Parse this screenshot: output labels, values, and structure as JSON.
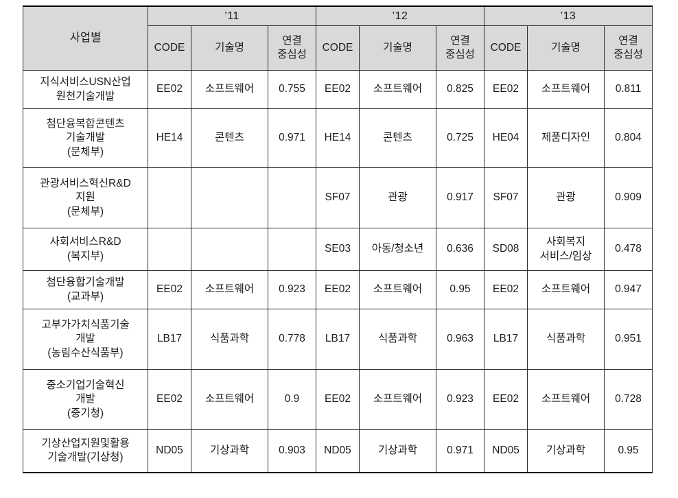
{
  "table": {
    "header": {
      "row_label": "사업별",
      "years": [
        "’11",
        "’12",
        "’13"
      ],
      "sub_columns": [
        "CODE",
        "기술명",
        "연결\n중심성"
      ],
      "sub_code": "CODE",
      "sub_tech": "기술명",
      "sub_centrality_line1": "연결",
      "sub_centrality_line2": "중심성"
    },
    "rows": [
      {
        "name_lines": [
          "지식서비스USN산업",
          "원천기술개발"
        ],
        "y11": {
          "code": "EE02",
          "tech": "소프트웨어",
          "centrality": "0.755"
        },
        "y12": {
          "code": "EE02",
          "tech": "소프트웨어",
          "centrality": "0.825"
        },
        "y13": {
          "code": "EE02",
          "tech": "소프트웨어",
          "centrality": "0.811"
        }
      },
      {
        "name_lines": [
          "첨단융복합콘텐츠",
          "기술개발",
          "(문체부)"
        ],
        "y11": {
          "code": "HE14",
          "tech": "콘텐츠",
          "centrality": "0.971"
        },
        "y12": {
          "code": "HE14",
          "tech": "콘텐츠",
          "centrality": "0.725"
        },
        "y13": {
          "code": "HE04",
          "tech": "제품디자인",
          "centrality": "0.804"
        }
      },
      {
        "name_lines": [
          "관광서비스혁신R&D",
          "지원",
          "(문체부)"
        ],
        "y11": {
          "code": "",
          "tech": "",
          "centrality": ""
        },
        "y12": {
          "code": "SF07",
          "tech": "관광",
          "centrality": "0.917"
        },
        "y13": {
          "code": "SF07",
          "tech": "관광",
          "centrality": "0.909"
        }
      },
      {
        "name_lines": [
          "사회서비스R&D",
          "(복지부)"
        ],
        "y11": {
          "code": "",
          "tech": "",
          "centrality": ""
        },
        "y12": {
          "code": "SE03",
          "tech": "아동/청소년",
          "centrality": "0.636"
        },
        "y13": {
          "code": "SD08",
          "tech": "사회복지\n서비스/임상",
          "centrality": "0.478"
        }
      },
      {
        "name_lines": [
          "첨단융합기술개발",
          "(교과부)"
        ],
        "y11": {
          "code": "EE02",
          "tech": "소프트웨어",
          "centrality": "0.923"
        },
        "y12": {
          "code": "EE02",
          "tech": "소프트웨어",
          "centrality": "0.95"
        },
        "y13": {
          "code": "EE02",
          "tech": "소프트웨어",
          "centrality": "0.947"
        }
      },
      {
        "name_lines": [
          "고부가가치식품기술",
          "개발",
          "(농림수산식품부)"
        ],
        "y11": {
          "code": "LB17",
          "tech": "식품과학",
          "centrality": "0.778"
        },
        "y12": {
          "code": "LB17",
          "tech": "식품과학",
          "centrality": "0.963"
        },
        "y13": {
          "code": "LB17",
          "tech": "식품과학",
          "centrality": "0.951"
        }
      },
      {
        "name_lines": [
          "중소기업기술혁신",
          "개발",
          "(중기청)"
        ],
        "y11": {
          "code": "EE02",
          "tech": "소프트웨어",
          "centrality": "0.9"
        },
        "y12": {
          "code": "EE02",
          "tech": "소프트웨어",
          "centrality": "0.923"
        },
        "y13": {
          "code": "EE02",
          "tech": "소프트웨어",
          "centrality": "0.728"
        }
      },
      {
        "name_lines": [
          "기상산업지원및활용",
          "기술개발(기상청)"
        ],
        "y11": {
          "code": "ND05",
          "tech": "기상과학",
          "centrality": "0.903"
        },
        "y12": {
          "code": "ND05",
          "tech": "기상과학",
          "centrality": "0.971"
        },
        "y13": {
          "code": "ND05",
          "tech": "기상과학",
          "centrality": "0.95"
        }
      }
    ]
  },
  "colors": {
    "header_background": "#d9d9d9",
    "border": "#2a2a2a",
    "outer_rule": "#000000",
    "text": "#1c1c1c"
  }
}
